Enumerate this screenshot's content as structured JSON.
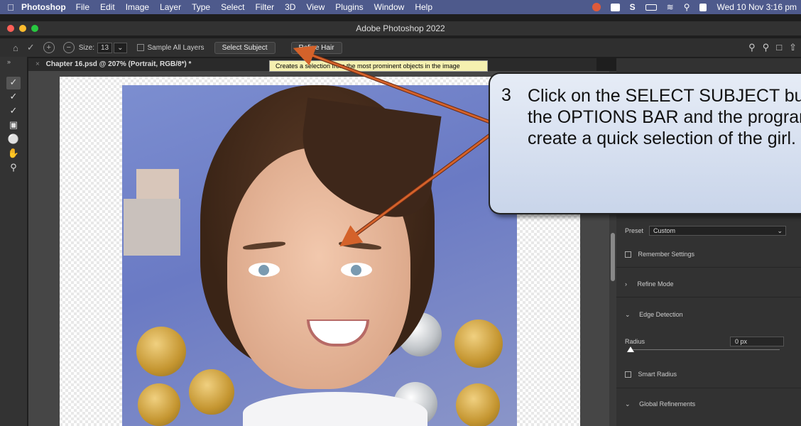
{
  "menubar": {
    "app": "Photoshop",
    "items": [
      "File",
      "Edit",
      "Image",
      "Layer",
      "Type",
      "Select",
      "Filter",
      "3D",
      "View",
      "Plugins",
      "Window",
      "Help"
    ],
    "clock": "Wed 10 Nov  3:16 pm"
  },
  "window": {
    "title": "Adobe Photoshop 2022"
  },
  "options": {
    "size_label": "Size:",
    "size_value": "13",
    "sample_all_layers": "Sample All Layers",
    "select_subject": "Select Subject",
    "refine_hair": "Refine Hair"
  },
  "tooltip": "Creates a selection from the most prominent objects in the image",
  "document": {
    "tab_title": "Chapter 16.psd @ 207% (Portrait, RGB/8*) *"
  },
  "panel": {
    "preset_label": "Preset",
    "preset_value": "Custom",
    "remember_settings": "Remember Settings",
    "refine_mode": "Refine Mode",
    "edge_detection": "Edge Detection",
    "radius_label": "Radius",
    "radius_value": "0 px",
    "smart_radius": "Smart Radius",
    "global_refinements": "Global Refinements"
  },
  "callout": {
    "number": "3",
    "text": "Click on the SELECT SUBJECT button in the OPTIONS BAR and the program will create a quick selection of the girl."
  },
  "colors": {
    "arrow": "#d4622a",
    "menubar": "#4e5a8c",
    "callout": "#d6dff0"
  }
}
